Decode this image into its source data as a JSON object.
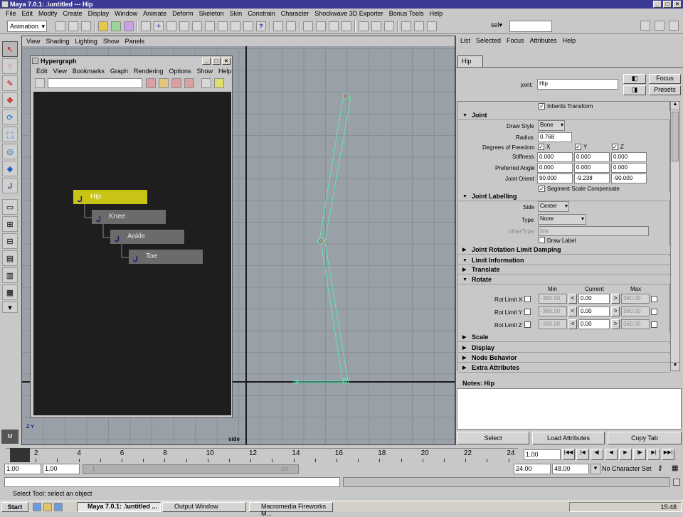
{
  "window": {
    "title": "Maya 7.0.1: .\\untitled  ---  Hip"
  },
  "menubar": [
    "File",
    "Edit",
    "Modify",
    "Create",
    "Display",
    "Window",
    "Animate",
    "Deform",
    "Skeleton",
    "Skin",
    "Constrain",
    "Character",
    "Shockwave 3D Exporter",
    "Bonus Tools",
    "Help"
  ],
  "shelf": {
    "mode": "Animation",
    "sel_label": "sel"
  },
  "viewport": {
    "menu": [
      "View",
      "Shading",
      "Lighting",
      "Show",
      "Panels"
    ],
    "label": "side",
    "axis": "Z Y"
  },
  "hypergraph": {
    "title": "Hypergraph",
    "menu": [
      "Edit",
      "View",
      "Bookmarks",
      "Graph",
      "Rendering",
      "Options",
      "Show",
      "Help"
    ],
    "nodes": [
      "Hip",
      "Knee",
      "Ankle",
      "Toe"
    ]
  },
  "attr_editor": {
    "menu": [
      "List",
      "Selected",
      "Focus",
      "Attributes",
      "Help"
    ],
    "tab": "Hip",
    "joint_label": "joint:",
    "joint_value": "Hip",
    "focus_btn": "Focus",
    "presets_btn": "Presets",
    "inherits": "Inherits Transform",
    "joint_section": "Joint",
    "draw_style_label": "Draw Style",
    "draw_style": "Bone",
    "radius_label": "Radius",
    "radius": "0.768",
    "dof_label": "Degrees of Freedom",
    "dof": [
      "X",
      "Y",
      "Z"
    ],
    "stiffness_label": "Stiffness",
    "stiffness": [
      "0.000",
      "0.000",
      "0.000"
    ],
    "pref_angle_label": "Preferred Angle",
    "pref_angle": [
      "0.000",
      "0.000",
      "0.000"
    ],
    "joint_orient_label": "Joint Orient",
    "joint_orient": [
      "90.000",
      "-9.238",
      "-90.000"
    ],
    "segment_scale": "Segment Scale Compensate",
    "labelling_section": "Joint Labelling",
    "side_label": "Side",
    "side": "Center",
    "type_label": "Type",
    "type": "None",
    "other_type_label": "otherType",
    "other_type": "jaw",
    "draw_label": "Draw Label",
    "sections_collapsed": [
      "Joint Rotation Limit Damping",
      "Limit Information",
      "Translate"
    ],
    "rotate_section": "Rotate",
    "rot_cols": [
      "Min",
      "Current",
      "Max"
    ],
    "rot_rows": [
      {
        "label": "Rot Limit X",
        "min": "-360.00",
        "cur": "0.00",
        "max": "360.00"
      },
      {
        "label": "Rot Limit Y",
        "min": "-360.00",
        "cur": "0.00",
        "max": "360.00"
      },
      {
        "label": "Rot Limit Z",
        "min": "-360.00",
        "cur": "0.00",
        "max": "360.00"
      }
    ],
    "sections_bottom": [
      "Scale",
      "Display",
      "Node Behavior",
      "Extra Attributes"
    ],
    "notes": "Notes:  Hip",
    "buttons": [
      "Select",
      "Load Attributes",
      "Copy Tab"
    ]
  },
  "timeline": {
    "ticks": [
      "2",
      "4",
      "6",
      "8",
      "10",
      "12",
      "14",
      "16",
      "18",
      "20",
      "22",
      "24"
    ],
    "current_frame": "1.00",
    "range_start": "1.00",
    "range_inner_start": "1.00",
    "slider_start": "1",
    "slider_end": "24",
    "range_end": "24.00",
    "anim_end": "48.00",
    "char_set": "No Character Set"
  },
  "status": "Select Tool: select an object",
  "taskbar": {
    "start": "Start",
    "items": [
      "Maya 7.0.1: .\\untitled ...",
      "Output Window",
      "Macromedia Fireworks M..."
    ],
    "clock": "15:48"
  }
}
